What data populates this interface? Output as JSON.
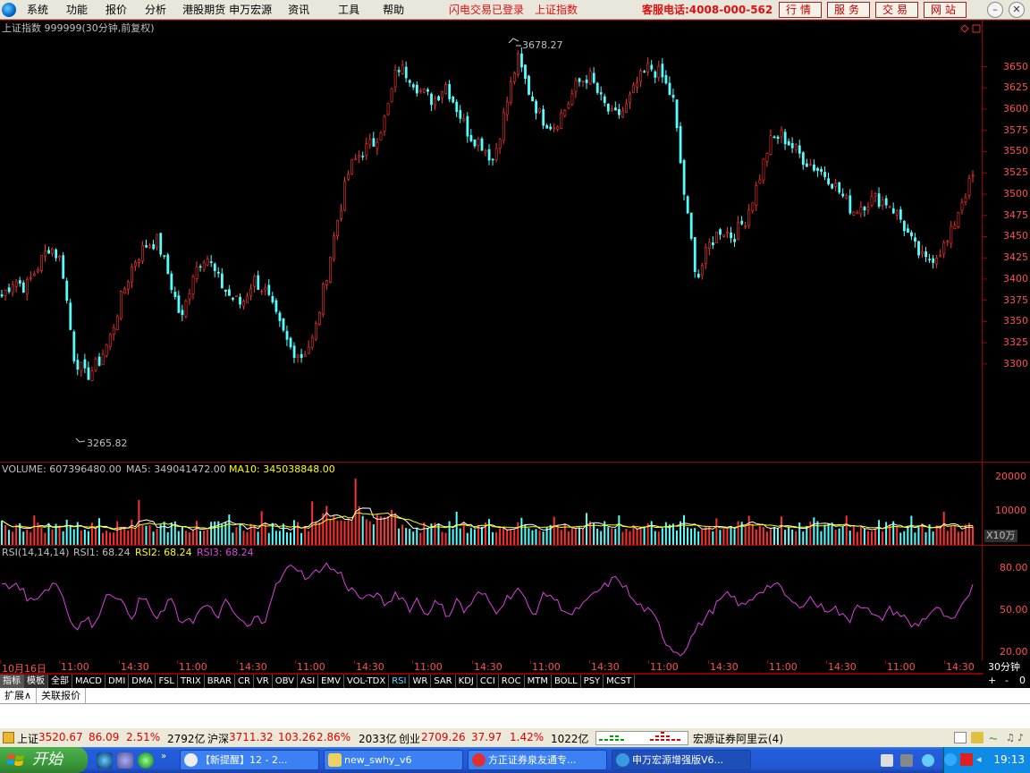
{
  "menubar": {
    "items": [
      "系统",
      "功能",
      "报价",
      "分析",
      "港股期货",
      "申万宏源",
      "资讯",
      "工具",
      "帮助"
    ],
    "flash_status": "闪电交易已登录",
    "flash_index": "上证指数",
    "hotline": "客服电话:4008-000-562",
    "buttons": [
      "行情",
      "服务",
      "交易",
      "网站"
    ]
  },
  "chart_header": {
    "title": "上证指数 999999(30分钟,前复权)",
    "high_label": "3678.27",
    "low_label": "3265.82"
  },
  "volume_header": {
    "volume_label": "VOLUME: 607396480.00",
    "ma5_label": "MA5: 349041472.00",
    "ma10_label": "MA10: 345038848.00",
    "unit": "X10万"
  },
  "rsi_header": {
    "params": "RSI(14,14,14)",
    "rsi1": "RSI1: 68.24",
    "rsi2": "RSI2: 68.24",
    "rsi3": "RSI3: 68.24"
  },
  "price_axis": [
    "3650",
    "3625",
    "3600",
    "3575",
    "3550",
    "3525",
    "3500",
    "3475",
    "3450",
    "3425",
    "3400",
    "3375",
    "3350",
    "3325",
    "3300"
  ],
  "volume_axis": [
    "20000",
    "10000"
  ],
  "rsi_axis": [
    "80.00",
    "50.00",
    "20.00"
  ],
  "time_axis": [
    "10月16日",
    "11:00",
    "14:30",
    "11:00",
    "14:30",
    "11:00",
    "14:30",
    "11:00",
    "14:30",
    "11:00",
    "14:30",
    "11:00",
    "14:30",
    "11:00",
    "14:30",
    "11:00",
    "14:30"
  ],
  "period_label": "30分钟",
  "zoom_buttons": [
    "+",
    "-",
    "0"
  ],
  "indicator_tabs": [
    "指标",
    "模板",
    "全部",
    "MACD",
    "DMI",
    "DMA",
    "FSL",
    "TRIX",
    "BRAR",
    "CR",
    "VR",
    "OBV",
    "ASI",
    "EMV",
    "VOL-TDX",
    "RSI",
    "WR",
    "SAR",
    "KDJ",
    "CCI",
    "ROC",
    "MTM",
    "BOLL",
    "PSY",
    "MCST"
  ],
  "active_tab": "RSI",
  "ext_tabs": [
    "扩展∧",
    "关联报价"
  ],
  "statusbar": {
    "sh_label": "上证",
    "sh_value": "3520.67",
    "sh_change": "86.09",
    "sh_pct": "2.51%",
    "sh_amount": "2792亿",
    "hs_label": "沪深",
    "hs_value": "3711.32",
    "hs_change": "103.26",
    "hs_pct": "2.86%",
    "hs_amount": "2033亿",
    "cy_label": "创业",
    "cy_value": "2709.26",
    "cy_change": "37.97",
    "cy_pct": "1.42%",
    "cy_amount": "1022亿",
    "server": "宏源证券阿里云(4)"
  },
  "taskbar": {
    "start_label": "开始",
    "tasks": [
      "【新提醒】12 - 2...",
      "new_swhy_v6",
      "方正证券泉友通专...",
      "申万宏源增强版V6..."
    ],
    "clock": "19:13"
  },
  "chart_data": [
    {
      "type": "candlestick",
      "title": "上证指数 999999(30分钟,前复权)",
      "ylim": [
        3265.82,
        3678.27
      ],
      "y_ticks": [
        3300,
        3325,
        3350,
        3375,
        3400,
        3425,
        3450,
        3475,
        3500,
        3525,
        3550,
        3575,
        3600,
        3625,
        3650
      ],
      "high": 3678.27,
      "low": 3265.82,
      "last_close": 3520.67,
      "close_path": [
        3380,
        3400,
        3390,
        3415,
        3440,
        3420,
        3310,
        3285,
        3300,
        3330,
        3380,
        3420,
        3440,
        3445,
        3400,
        3350,
        3410,
        3430,
        3400,
        3380,
        3370,
        3400,
        3385,
        3350,
        3320,
        3310,
        3330,
        3400,
        3470,
        3530,
        3550,
        3560,
        3590,
        3650,
        3640,
        3620,
        3610,
        3630,
        3600,
        3570,
        3560,
        3540,
        3600,
        3660,
        3620,
        3590,
        3580,
        3600,
        3630,
        3640,
        3610,
        3590,
        3600,
        3630,
        3650,
        3640,
        3610,
        3490,
        3400,
        3440,
        3460,
        3450,
        3470,
        3510,
        3560,
        3570,
        3555,
        3540,
        3530,
        3520,
        3500,
        3480,
        3490,
        3495,
        3490,
        3470,
        3440,
        3420,
        3430,
        3445,
        3490,
        3520
      ],
      "dates": [
        "10月16日"
      ]
    },
    {
      "type": "bar",
      "title": "VOLUME",
      "unit": "X10万",
      "volume_last": 607396480.0,
      "ma5": 349041472.0,
      "ma10": 345038848.0,
      "y_ticks": [
        10000,
        20000
      ]
    },
    {
      "type": "line",
      "title": "RSI(14,14,14)",
      "ylim": [
        20,
        80
      ],
      "y_ticks": [
        20,
        50,
        80
      ],
      "series": [
        {
          "name": "RSI1",
          "last": 68.24
        },
        {
          "name": "RSI2",
          "last": 68.24
        },
        {
          "name": "RSI3",
          "last": 68.24
        }
      ]
    }
  ],
  "colors": {
    "up": "#ff3232",
    "down": "#54ffff",
    "ma10": "#ffff00",
    "ma5": "#ffffff",
    "rsi": "#e040e0",
    "grid": "#a00000",
    "axis_text": "#ff5050"
  }
}
